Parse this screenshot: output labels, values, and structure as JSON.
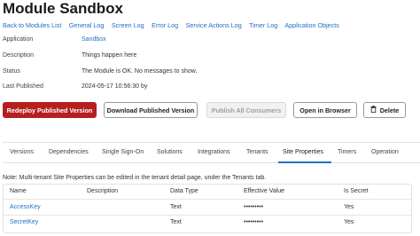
{
  "page": {
    "title": "Module Sandbox"
  },
  "nav": {
    "links": [
      "Back to Modules List",
      "General Log",
      "Screen Log",
      "Error Log",
      "Service Actions Log",
      "Timer Log",
      "Application Objects"
    ]
  },
  "details": {
    "application_label": "Application",
    "application_value": "Sandbox",
    "description_label": "Description",
    "description_value": "Things happen here",
    "status_label": "Status",
    "status_value": "The Module is OK. No messages to show.",
    "last_published_label": "Last Published",
    "last_published_value": "2024-05-17 10:56:30  by"
  },
  "actions": {
    "redeploy": "Redeploy Published Version",
    "download": "Download Published Version",
    "publish_all": "Publish All Consumers",
    "open_browser": "Open in Browser",
    "delete": "Delete",
    "delete_icon": "trash-icon"
  },
  "tabs": [
    "Versions",
    "Dependencies",
    "Single Sign-On",
    "Solutions",
    "Integrations",
    "Tenants",
    "Site Properties",
    "Timers",
    "Operation"
  ],
  "active_tab": "Site Properties",
  "note": "Note: Multi-tenant Site Properties can be edited in the tenant detail page, under the Tenants tab.",
  "table": {
    "headers": [
      "Name",
      "Description",
      "Data Type",
      "Effective Value",
      "Is Secret"
    ],
    "rows": [
      {
        "name": "AccessKey",
        "description": "",
        "data_type": "Text",
        "effective_value": "•••••••••",
        "is_secret": "Yes"
      },
      {
        "name": "SecretKey",
        "description": "",
        "data_type": "Text",
        "effective_value": "•••••••••",
        "is_secret": "Yes"
      }
    ]
  },
  "colors": {
    "primary": "#b61f1f",
    "link": "#1f6fc5"
  }
}
